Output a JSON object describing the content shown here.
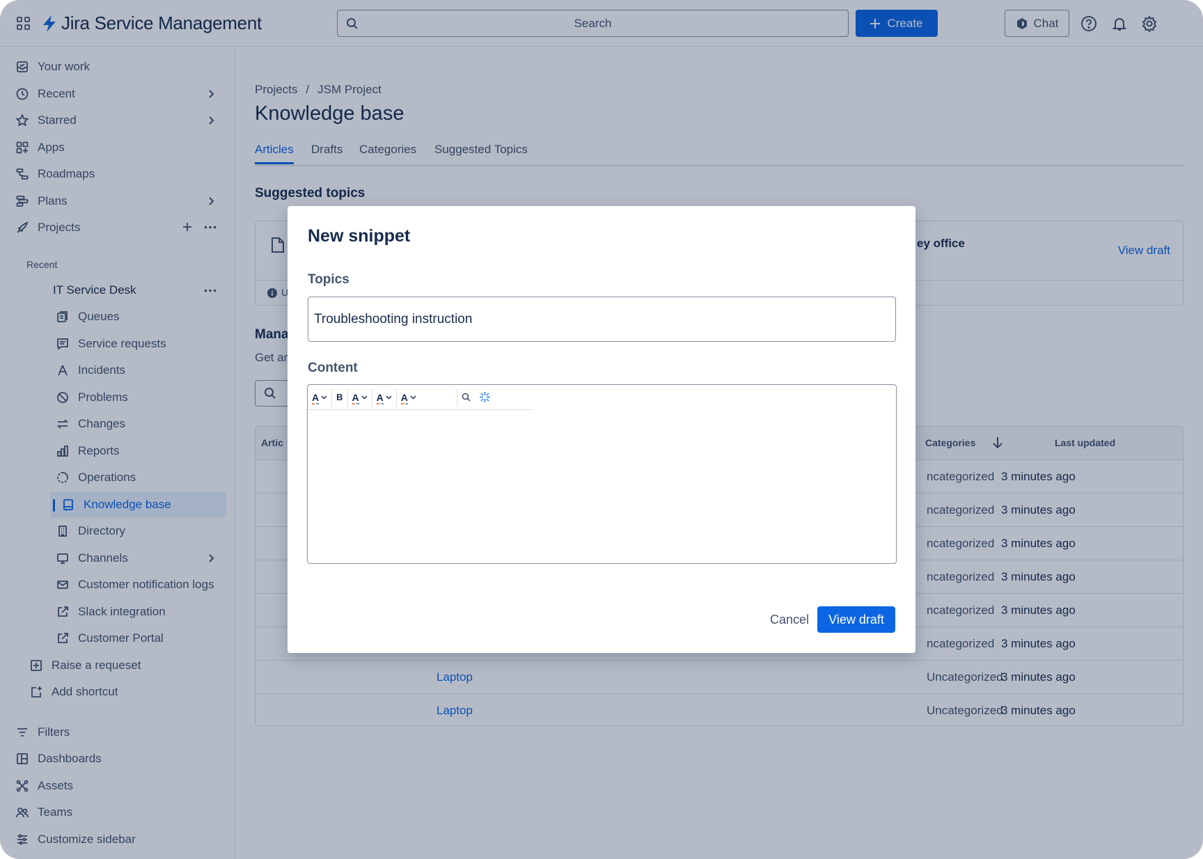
{
  "topbar": {
    "product_name": "Jira Service Management",
    "search_placeholder": "Search",
    "create_label": "Create",
    "chat_label": "Chat"
  },
  "sidebar": {
    "top_items": [
      {
        "label": "Your work",
        "icon": "inbox-icon"
      },
      {
        "label": "Recent",
        "icon": "clock-icon"
      },
      {
        "label": "Starred",
        "icon": "star-icon"
      },
      {
        "label": "Apps",
        "icon": "apps-icon"
      },
      {
        "label": "Roadmaps",
        "icon": "roadmap-icon"
      },
      {
        "label": "Plans",
        "icon": "plans-icon"
      },
      {
        "label": "Projects",
        "icon": "rocket-icon"
      }
    ],
    "recent_label": "Recent",
    "project_name": "IT Service Desk",
    "project_items": [
      {
        "label": "Queues",
        "icon": "queues-icon"
      },
      {
        "label": "Service requests",
        "icon": "comment-icon"
      },
      {
        "label": "Incidents",
        "icon": "incident-icon"
      },
      {
        "label": "Problems",
        "icon": "problem-icon"
      },
      {
        "label": "Changes",
        "icon": "changes-icon"
      },
      {
        "label": "Reports",
        "icon": "reports-icon"
      },
      {
        "label": "Operations",
        "icon": "operations-icon"
      },
      {
        "label": "Knowledge base",
        "icon": "book-icon"
      },
      {
        "label": "Directory",
        "icon": "building-icon"
      },
      {
        "label": "Channels",
        "icon": "monitor-icon"
      },
      {
        "label": "Customer notification logs",
        "icon": "email-icon"
      },
      {
        "label": "Slack integration",
        "icon": "external-link-icon"
      },
      {
        "label": "Customer Portal",
        "icon": "external-link-icon"
      }
    ],
    "raise_request": "Raise a requeset",
    "add_shortcut": "Add shortcut",
    "bottom_items": [
      {
        "label": "Filters",
        "icon": "filter-icon"
      },
      {
        "label": "Dashboards",
        "icon": "dashboard-icon"
      },
      {
        "label": "Assets",
        "icon": "assets-icon"
      },
      {
        "label": "Teams",
        "icon": "people-icon"
      },
      {
        "label": "Customize sidebar",
        "icon": "customize-icon"
      }
    ]
  },
  "main": {
    "breadcrumb": [
      "Projects",
      "/",
      "JSM Project"
    ],
    "title": "Knowledge base",
    "tabs": [
      "Articles",
      "Drafts",
      "Categories",
      "Suggested Topics"
    ],
    "suggested_title": "Suggested topics",
    "card_title_fragment": "ey office",
    "card_info_fragment": "U",
    "card_link": "View draft",
    "manage_fragment": "Mana",
    "manage_sub_fragment": "Get ar",
    "table": {
      "headers": {
        "article": "Artic",
        "categories": "Categories",
        "updated": "Last updated"
      },
      "rows": [
        {
          "title": "",
          "category": "ncategorized",
          "updated": "3 minutes ago"
        },
        {
          "title": "",
          "category": "ncategorized",
          "updated": "3 minutes ago"
        },
        {
          "title": "",
          "category": "ncategorized",
          "updated": "3 minutes ago"
        },
        {
          "title": "",
          "category": "ncategorized",
          "updated": "3 minutes ago"
        },
        {
          "title": "",
          "category": "ncategorized",
          "updated": "3 minutes ago"
        },
        {
          "title": "",
          "category": "ncategorized",
          "updated": "3 minutes ago"
        },
        {
          "title": "Laptop",
          "category": "Uncategorized",
          "updated": "3 minutes ago"
        },
        {
          "title": "Laptop",
          "category": "Uncategorized",
          "updated": "3 minutes ago"
        }
      ]
    }
  },
  "modal": {
    "title": "New snippet",
    "topics_label": "Topics",
    "topics_value": "Troubleshooting instruction",
    "content_label": "Content",
    "toolbar": {
      "bold": "B",
      "font_color": "A"
    },
    "cancel_label": "Cancel",
    "submit_label": "View draft"
  },
  "colors": {
    "brand": "#0c66e4",
    "text": "#172b4d",
    "subtle": "#44546f",
    "overlay": "rgba(9,30,66,0.30)"
  }
}
